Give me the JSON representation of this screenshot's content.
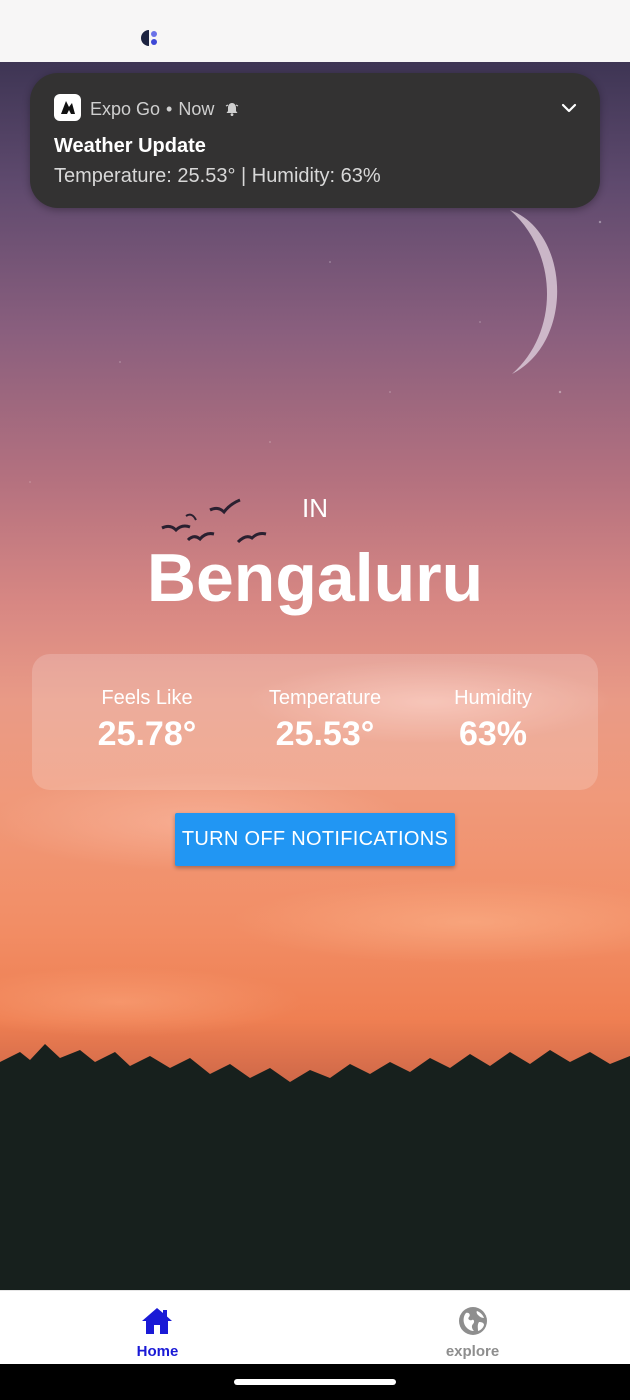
{
  "notification": {
    "app_name": "Expo Go",
    "separator": "•",
    "time": "Now",
    "title": "Weather Update",
    "body": "Temperature: 25.53° | Humidity: 63%"
  },
  "location": {
    "country": "IN",
    "city": "Bengaluru"
  },
  "weather": {
    "feels_like_label": "Feels Like",
    "feels_like_value": "25.78°",
    "temperature_label": "Temperature",
    "temperature_value": "25.53°",
    "humidity_label": "Humidity",
    "humidity_value": "63%"
  },
  "actions": {
    "toggle_notifications_label": "TURN OFF NOTIFICATIONS"
  },
  "tabs": [
    {
      "label": "Home",
      "icon": "home-icon",
      "active": true
    },
    {
      "label": "explore",
      "icon": "globe-icon",
      "active": false
    }
  ],
  "colors": {
    "accent_button": "#2196f3",
    "active_tab": "#1a1ad6",
    "inactive_tab": "#8e8e8e",
    "notification_bg": "#333232"
  }
}
